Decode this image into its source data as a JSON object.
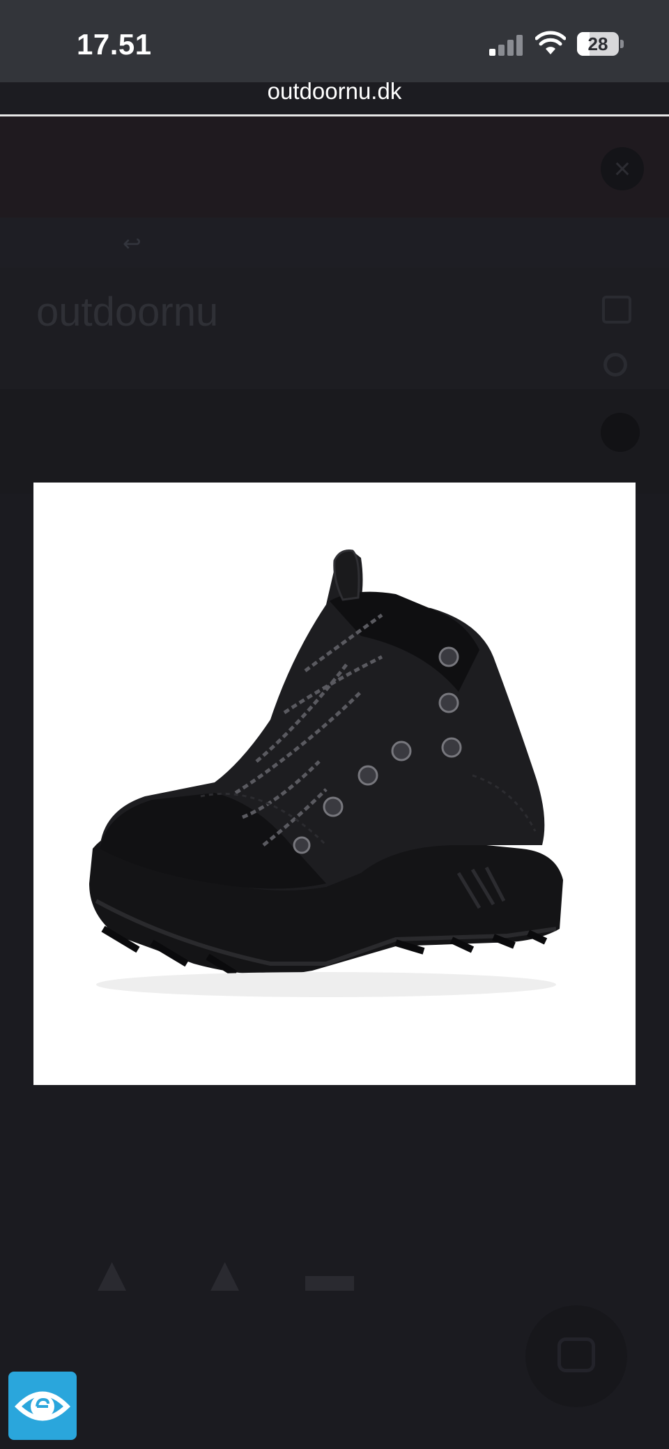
{
  "status_bar": {
    "time": "17.51",
    "battery": "28",
    "icons": [
      "cellular-signal-icon",
      "wifi-icon",
      "battery-icon"
    ]
  },
  "browser": {
    "url": "outdoornu.dk"
  },
  "background_page": {
    "banner_text": "",
    "reset_text": "",
    "logo_text": "outdoornu",
    "search_placeholder": "",
    "usp_text": ""
  },
  "modal": {
    "image_alt": "",
    "product_image": "black-hiking-boot"
  },
  "accessibility_widget": {
    "icon": "eye-icon",
    "color": "#2aa6dc"
  },
  "colors": {
    "status_bar": "#33353a",
    "page_overlay": "#1c1c21",
    "modal_background": "#ffffff"
  }
}
